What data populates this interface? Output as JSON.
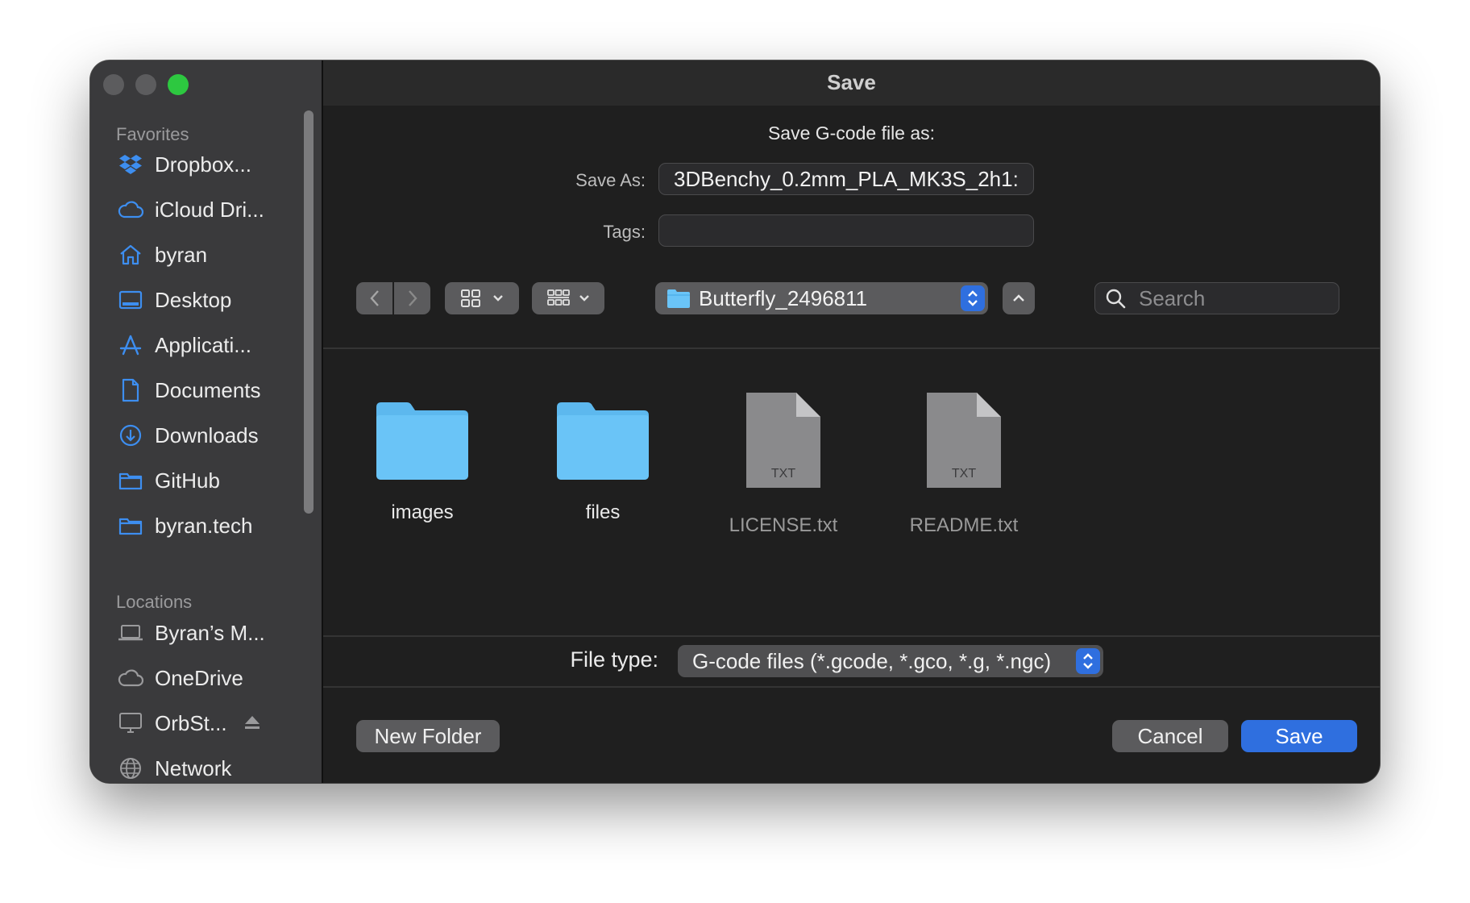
{
  "window": {
    "title": "Save"
  },
  "sidebar": {
    "favorites_label": "Favorites",
    "locations_label": "Locations",
    "favorites": [
      {
        "label": "Dropbox...",
        "icon": "dropbox-icon"
      },
      {
        "label": "iCloud Dri...",
        "icon": "cloud-icon"
      },
      {
        "label": "byran",
        "icon": "home-icon"
      },
      {
        "label": "Desktop",
        "icon": "desktop-icon"
      },
      {
        "label": "Applicati...",
        "icon": "applications-icon"
      },
      {
        "label": "Documents",
        "icon": "document-icon"
      },
      {
        "label": "Downloads",
        "icon": "downloads-icon"
      },
      {
        "label": "GitHub",
        "icon": "folder-icon"
      },
      {
        "label": "byran.tech",
        "icon": "folder-icon"
      }
    ],
    "locations": [
      {
        "label": "Byran’s M...",
        "icon": "laptop-icon"
      },
      {
        "label": "OneDrive",
        "icon": "cloud-icon"
      },
      {
        "label": "OrbSt...",
        "icon": "display-icon"
      },
      {
        "label": "Network",
        "icon": "network-icon"
      }
    ]
  },
  "dialog": {
    "prompt": "Save G-code file as:",
    "save_as_label": "Save As:",
    "save_as_value": "3DBenchy_0.2mm_PLA_MK3S_2h1:",
    "tags_label": "Tags:",
    "tags_value": "",
    "location": "Butterfly_2496811",
    "search_placeholder": "Search",
    "file_type_label": "File type:",
    "file_type_value": "G-code files (*.gcode, *.gco, *.g, *.ngc)",
    "new_folder": "New Folder",
    "cancel": "Cancel",
    "save": "Save"
  },
  "files": [
    {
      "name": "images",
      "kind": "folder"
    },
    {
      "name": "files",
      "kind": "folder"
    },
    {
      "name": "LICENSE.txt",
      "kind": "txt",
      "badge": "TXT"
    },
    {
      "name": "README.txt",
      "kind": "txt",
      "badge": "TXT"
    }
  ],
  "colors": {
    "accent": "#2f6fdf",
    "folder": "#6ac4f7",
    "sidebar_icon": "#3d8ef0",
    "close_inactive": "#5c5c5e",
    "zoom": "#2dc840"
  }
}
